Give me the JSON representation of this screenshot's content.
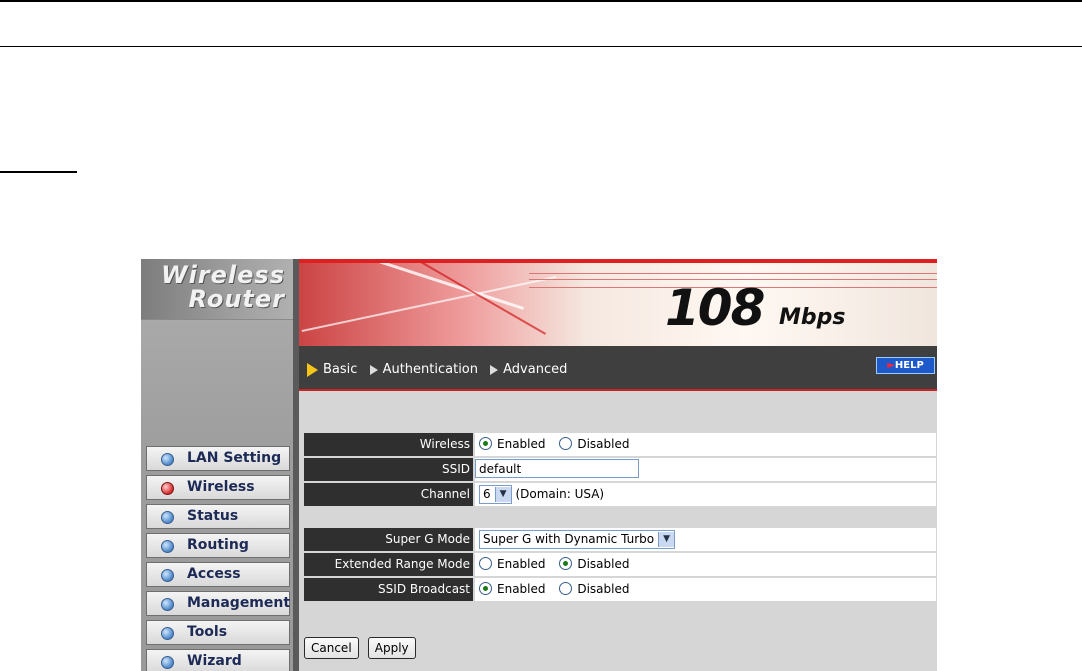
{
  "app": {
    "logo_line1": "Wireless",
    "logo_line2": "Router",
    "speed": "108",
    "speed_unit": "Mbps",
    "help_label": "HELP"
  },
  "menu": [
    {
      "label": "LAN Setting",
      "active": false
    },
    {
      "label": "Wireless",
      "active": true
    },
    {
      "label": "Status",
      "active": false
    },
    {
      "label": "Routing",
      "active": false
    },
    {
      "label": "Access",
      "active": false
    },
    {
      "label": "Management",
      "active": false
    },
    {
      "label": "Tools",
      "active": false
    },
    {
      "label": "Wizard",
      "active": false
    }
  ],
  "tabs": [
    {
      "label": "Basic",
      "active": true
    },
    {
      "label": "Authentication",
      "active": false
    },
    {
      "label": "Advanced",
      "active": false
    }
  ],
  "form": {
    "wireless": {
      "label": "Wireless",
      "enabled": "Enabled",
      "disabled": "Disabled",
      "selected": "Enabled"
    },
    "ssid": {
      "label": "SSID",
      "value": "default"
    },
    "channel": {
      "label": "Channel",
      "value": "6",
      "domain": "(Domain: USA)"
    },
    "superg": {
      "label": "Super G Mode",
      "value": "Super G with Dynamic Turbo"
    },
    "extended": {
      "label": "Extended Range Mode",
      "enabled": "Enabled",
      "disabled": "Disabled",
      "selected": "Disabled"
    },
    "broadcast": {
      "label": "SSID Broadcast",
      "enabled": "Enabled",
      "disabled": "Disabled",
      "selected": "Enabled"
    }
  },
  "buttons": {
    "cancel": "Cancel",
    "apply": "Apply"
  },
  "colors": {
    "accent": "#e02020",
    "tabbar": "#3f3f3f",
    "label_bg": "#2f2f2f",
    "help": "#1e59c9"
  }
}
